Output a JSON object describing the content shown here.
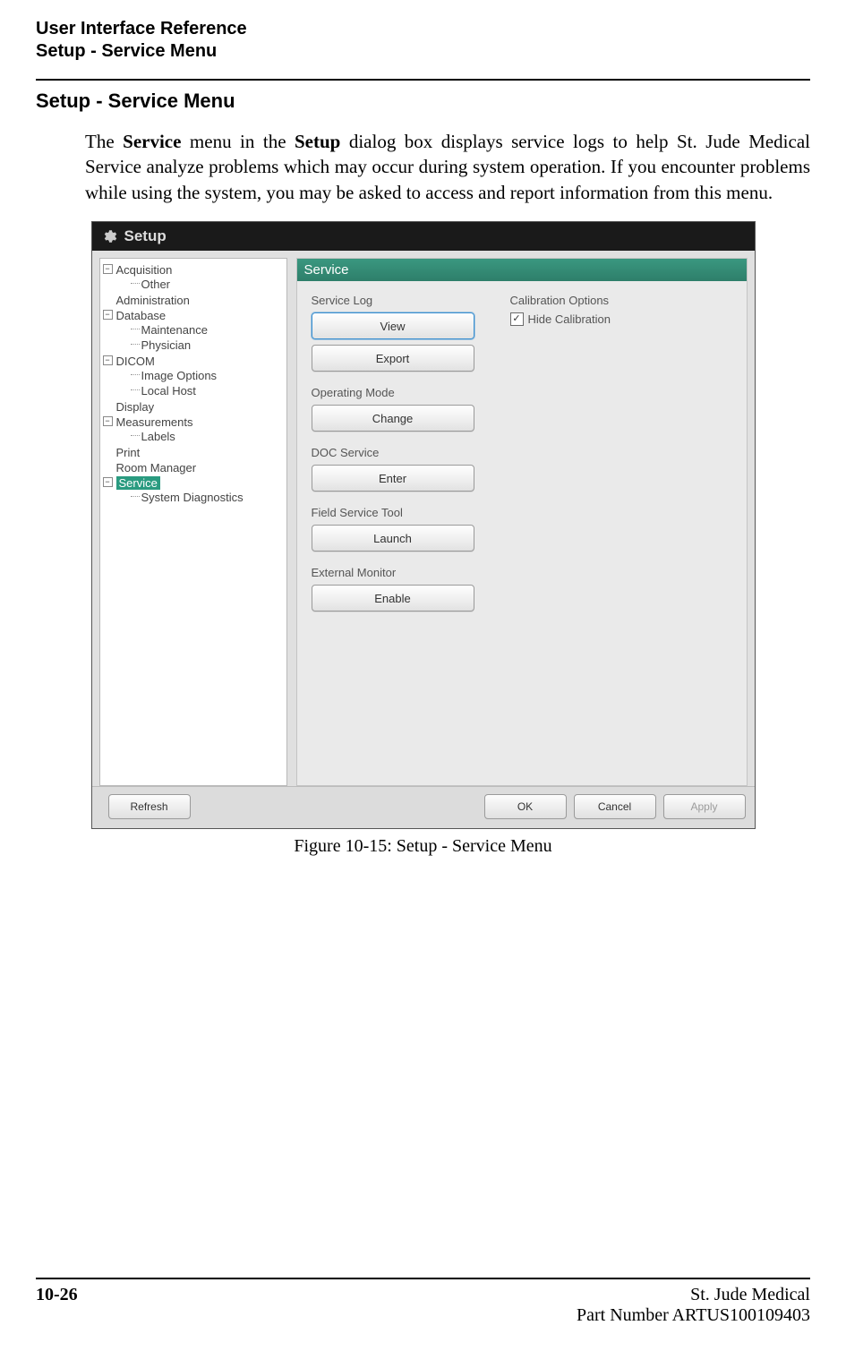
{
  "header": {
    "line1": "User Interface Reference",
    "line2": "Setup - Service Menu"
  },
  "section_heading": "Setup - Service Menu",
  "paragraph": {
    "pre1": "The ",
    "bold1": "Service",
    "mid1": " menu in the ",
    "bold2": "Setup",
    "post": " dialog box displays service logs to help St. Jude Medical Service analyze problems which may occur during system operation. If you encounter problems while using the system, you may be asked to access and report information from this menu."
  },
  "dialog": {
    "title": "Setup",
    "tree": {
      "acquisition": "Acquisition",
      "acquisition_other": "Other",
      "administration": "Administration",
      "database": "Database",
      "database_maintenance": "Maintenance",
      "database_physician": "Physician",
      "dicom": "DICOM",
      "dicom_image_options": "Image Options",
      "dicom_local_host": "Local Host",
      "display": "Display",
      "measurements": "Measurements",
      "measurements_labels": "Labels",
      "print": "Print",
      "room_manager": "Room Manager",
      "service": "Service",
      "service_system_diagnostics": "System Diagnostics"
    },
    "content": {
      "panel_title": "Service",
      "service_log_label": "Service Log",
      "view_btn": "View",
      "export_btn": "Export",
      "operating_mode_label": "Operating Mode",
      "change_btn": "Change",
      "doc_service_label": "DOC Service",
      "enter_btn": "Enter",
      "field_service_tool_label": "Field Service Tool",
      "launch_btn": "Launch",
      "external_monitor_label": "External Monitor",
      "enable_btn": "Enable",
      "calibration_options_label": "Calibration Options",
      "hide_calibration_label": "Hide Calibration"
    },
    "footer": {
      "refresh": "Refresh",
      "ok": "OK",
      "cancel": "Cancel",
      "apply": "Apply"
    }
  },
  "figure_caption": "Figure 10-15:  Setup - Service Menu",
  "footer": {
    "page_number": "10-26",
    "company": "St. Jude Medical",
    "part_number": "Part Number ARTUS100109403"
  }
}
